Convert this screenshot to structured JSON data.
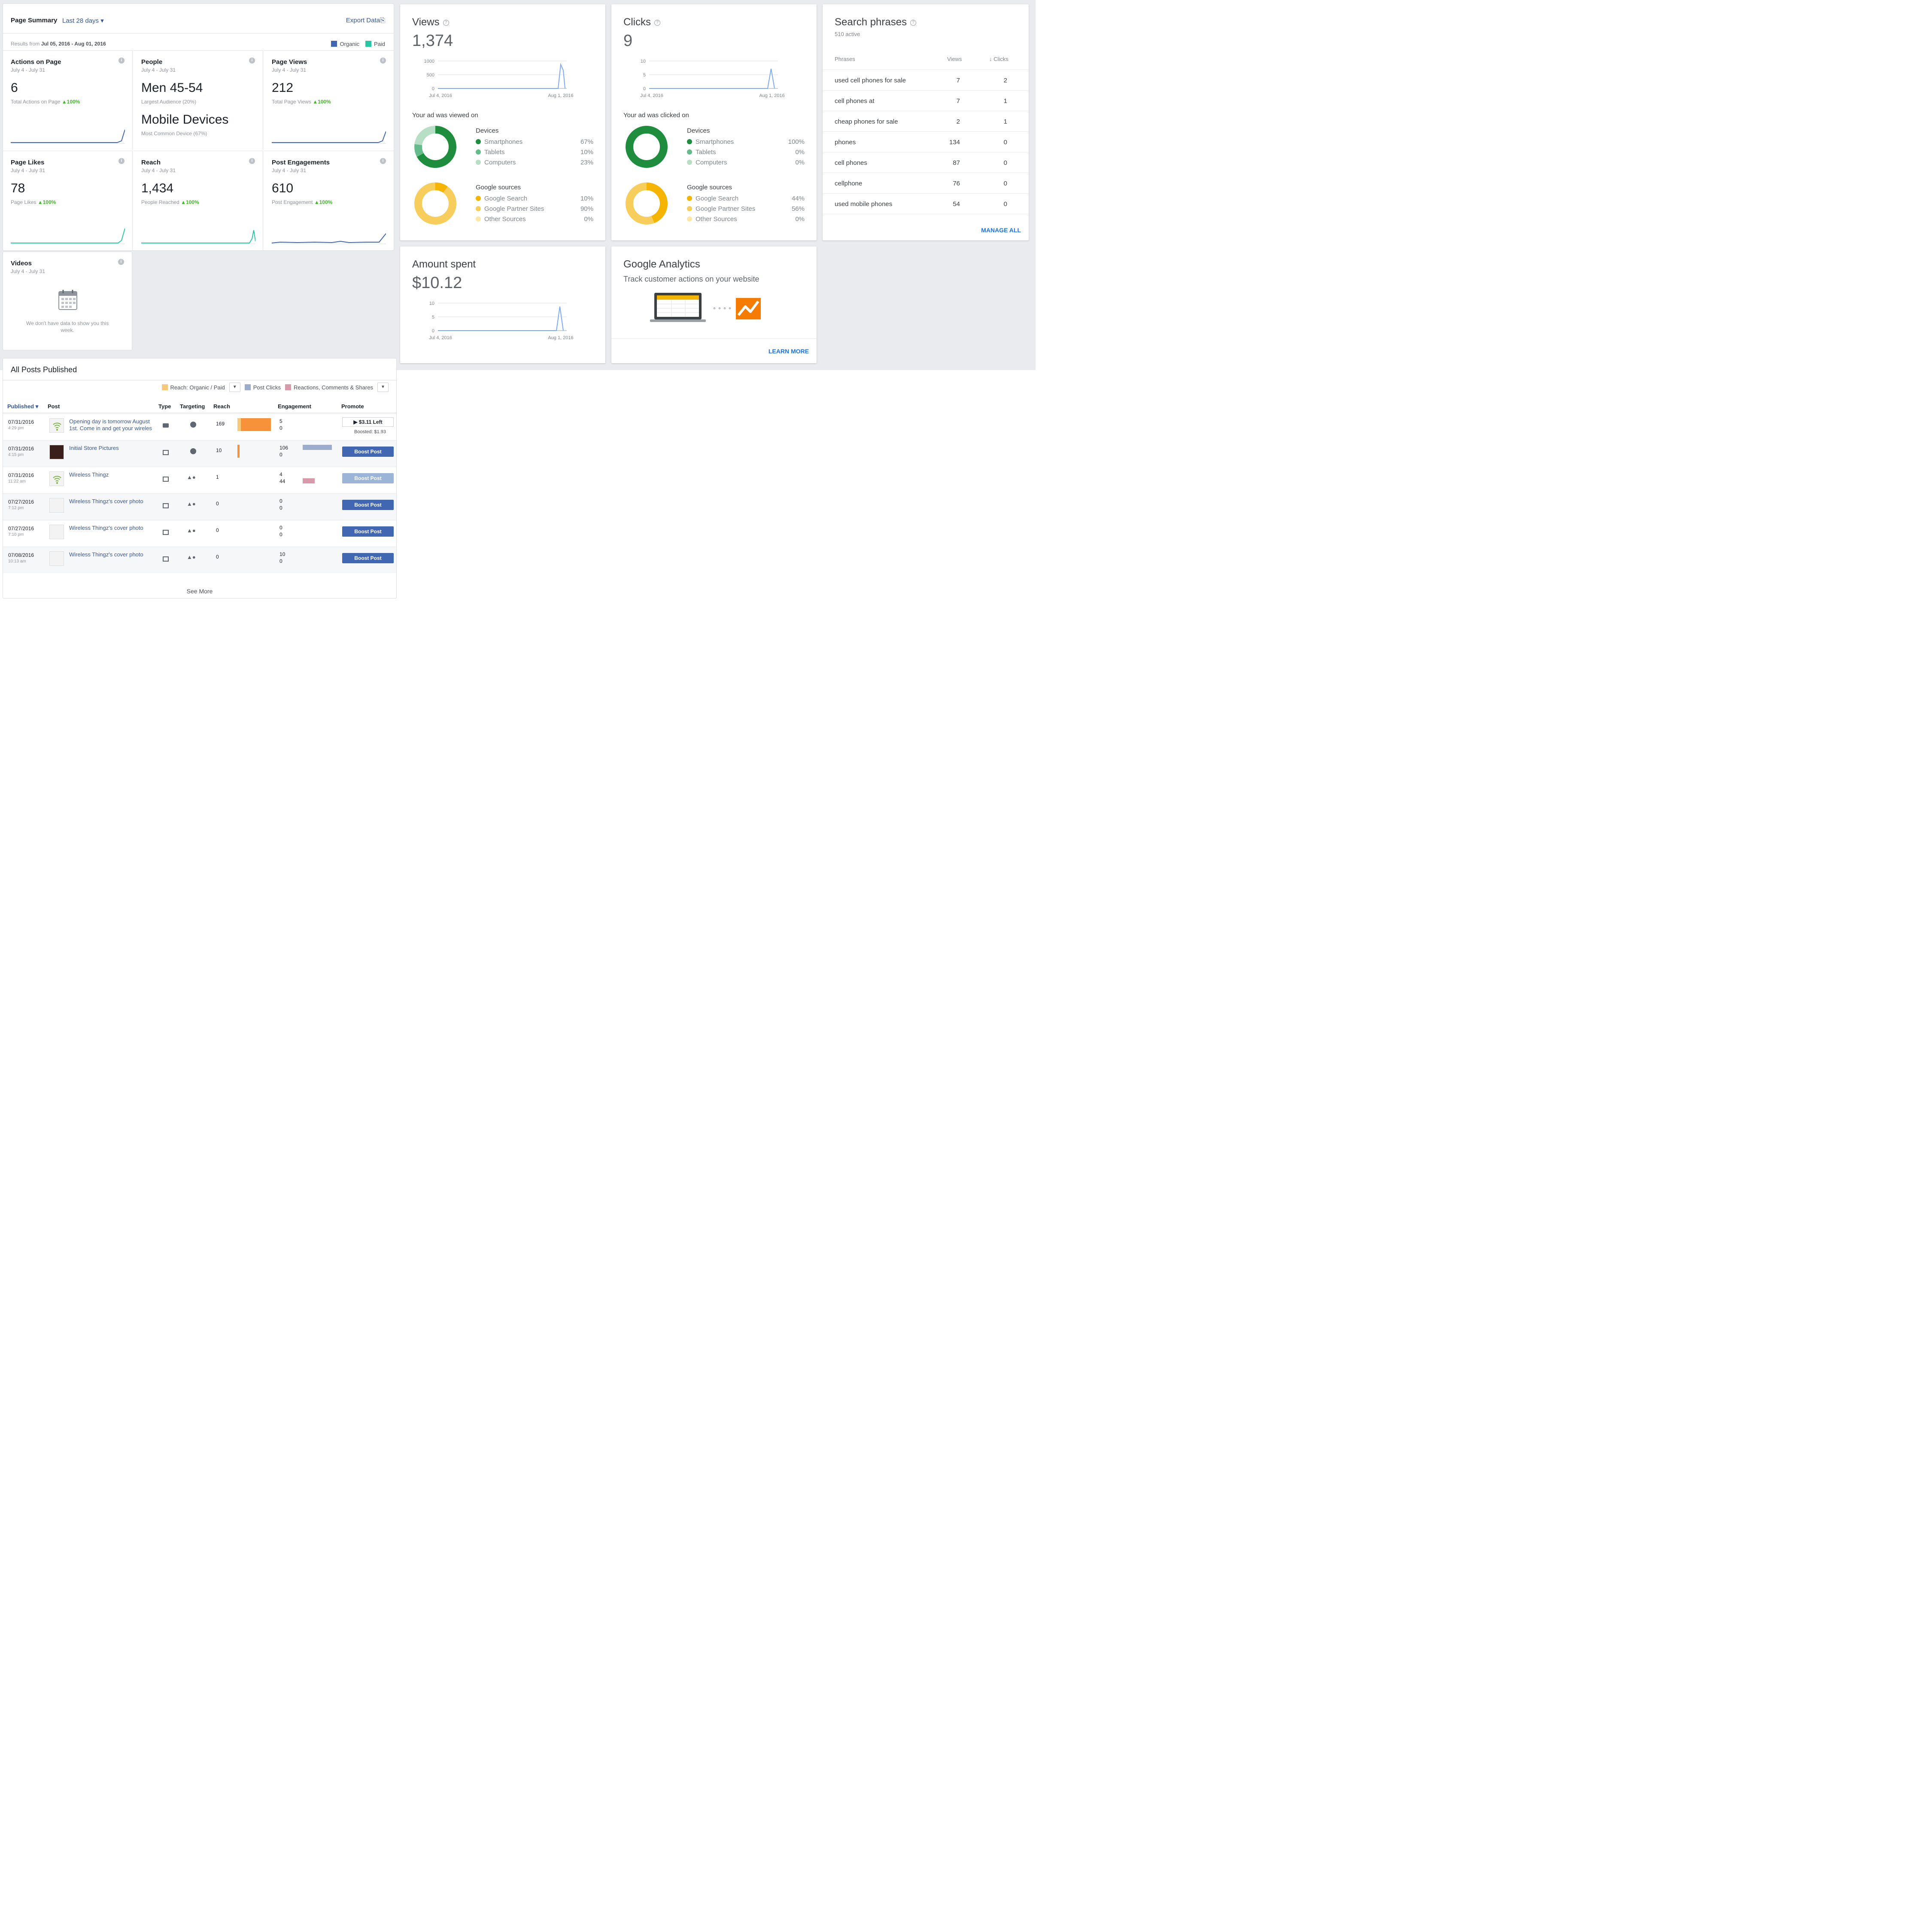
{
  "summary": {
    "title": "Page Summary",
    "range": "Last 28 days ▾",
    "export": "Export Data⎘",
    "legend": {
      "organic": "Organic",
      "paid": "Paid",
      "organic_color": "#4267b2",
      "paid_color": "#29c7a3"
    },
    "results_prefix": "Results from",
    "results_range": "Jul 05, 2016 - Aug 01, 2016",
    "tiles": [
      {
        "title": "Actions on Page",
        "date": "July 4 - July 31",
        "big": "6",
        "sub": "Total Actions on Page",
        "pct": "▲100%"
      },
      {
        "title": "People",
        "date": "July 4 - July 31",
        "big": "Men 45-54",
        "sub": "Largest Audience (20%)",
        "big2": "Mobile Devices",
        "sub2": "Most Common Device (67%)"
      },
      {
        "title": "Page Views",
        "date": "July 4 - July 31",
        "big": "212",
        "sub": "Total Page Views",
        "pct": "▲100%"
      },
      {
        "title": "Page Likes",
        "date": "July 4 - July 31",
        "big": "78",
        "sub": "Page Likes",
        "pct": "▲100%"
      },
      {
        "title": "Reach",
        "date": "July 4 - July 31",
        "big": "1,434",
        "sub": "People Reached",
        "pct": "▲100%"
      },
      {
        "title": "Post Engagements",
        "date": "July 4 - July 31",
        "big": "610",
        "sub": "Post Engagement",
        "pct": "▲100%"
      }
    ],
    "videos": {
      "title": "Videos",
      "date": "July 4 - July 31",
      "empty": "We don't have data to show you this week."
    }
  },
  "posts": {
    "title": "All Posts Published",
    "legend": [
      "Reach: Organic / Paid",
      "Post Clicks",
      "Reactions, Comments & Shares"
    ],
    "legend_colors": [
      "#f7c97a",
      "#9daccb",
      "#d79bab"
    ],
    "headers": [
      "Published ▾",
      "Post",
      "Type",
      "Targeting",
      "Reach",
      "Engagement",
      "Promote"
    ],
    "rows": [
      {
        "date": "07/31/2016",
        "time": "4:29 pm",
        "post": "Opening day is tomorrow August 1st. Come in and get your wireles",
        "reach": "169",
        "eng1": "5",
        "eng2": "0",
        "promote": "$3.11 Left",
        "boosted": "Boosted: $1.93"
      },
      {
        "date": "07/31/2016",
        "time": "4:15 pm",
        "post": "Initial Store Pictures",
        "reach": "10",
        "eng1": "106",
        "eng2": "0",
        "promote": "Boost Post"
      },
      {
        "date": "07/31/2016",
        "time": "11:22 am",
        "post": "Wireless Thingz",
        "reach": "1",
        "eng1": "4",
        "eng2": "44",
        "promote": "Boost Post"
      },
      {
        "date": "07/27/2016",
        "time": "7:12 pm",
        "post": "Wireless Thingz's cover photo",
        "reach": "0",
        "eng1": "0",
        "eng2": "0",
        "promote": "Boost Post"
      },
      {
        "date": "07/27/2016",
        "time": "7:10 pm",
        "post": "Wireless Thingz's cover photo",
        "reach": "0",
        "eng1": "0",
        "eng2": "0",
        "promote": "Boost Post"
      },
      {
        "date": "07/08/2016",
        "time": "10:13 am",
        "post": "Wireless Thingz's cover photo",
        "reach": "0",
        "eng1": "10",
        "eng2": "0",
        "promote": "Boost Post"
      }
    ],
    "see_more": "See More"
  },
  "views": {
    "title": "Views",
    "big": "1,374",
    "yticks": [
      "1000",
      "500",
      "0"
    ],
    "xticks": [
      "Jul 4, 2016",
      "Aug 1, 2016"
    ],
    "section": "Your ad was viewed on",
    "devices_title": "Devices",
    "devices": [
      {
        "label": "Smartphones",
        "pct": "67%",
        "value": 67
      },
      {
        "label": "Tablets",
        "pct": "10%",
        "value": 10
      },
      {
        "label": "Computers",
        "pct": "23%",
        "value": 23
      }
    ],
    "sources_title": "Google sources",
    "sources": [
      {
        "label": "Google Search",
        "pct": "10%",
        "value": 10
      },
      {
        "label": "Google Partner Sites",
        "pct": "90%",
        "value": 90
      },
      {
        "label": "Other Sources",
        "pct": "0%",
        "value": 0
      }
    ]
  },
  "clicks": {
    "title": "Clicks",
    "big": "9",
    "yticks": [
      "10",
      "5",
      "0"
    ],
    "xticks": [
      "Jul 4, 2016",
      "Aug 1, 2016"
    ],
    "section": "Your ad was clicked on",
    "devices_title": "Devices",
    "devices": [
      {
        "label": "Smartphones",
        "pct": "100%",
        "value": 100
      },
      {
        "label": "Tablets",
        "pct": "0%",
        "value": 0
      },
      {
        "label": "Computers",
        "pct": "0%",
        "value": 0
      }
    ],
    "sources_title": "Google sources",
    "sources": [
      {
        "label": "Google Search",
        "pct": "44%",
        "value": 44
      },
      {
        "label": "Google Partner Sites",
        "pct": "56%",
        "value": 56
      },
      {
        "label": "Other Sources",
        "pct": "0%",
        "value": 0
      }
    ]
  },
  "search": {
    "title": "Search phrases",
    "sub": "510 active",
    "headers": [
      "Phrases",
      "Views",
      "↓ Clicks"
    ],
    "rows": [
      {
        "phrase": "used cell phones for sale",
        "views": "7",
        "clicks": "2"
      },
      {
        "phrase": "cell phones at",
        "views": "7",
        "clicks": "1"
      },
      {
        "phrase": "cheap phones for sale",
        "views": "2",
        "clicks": "1"
      },
      {
        "phrase": "phones",
        "views": "134",
        "clicks": "0"
      },
      {
        "phrase": "cell phones",
        "views": "87",
        "clicks": "0"
      },
      {
        "phrase": "cellphone",
        "views": "76",
        "clicks": "0"
      },
      {
        "phrase": "used mobile phones",
        "views": "54",
        "clicks": "0"
      }
    ],
    "manage": "MANAGE ALL"
  },
  "amount": {
    "title": "Amount spent",
    "big": "$10.12",
    "yticks": [
      "10",
      "5",
      "0"
    ],
    "xticks": [
      "Jul 4, 2016",
      "Aug 1, 2016"
    ]
  },
  "analytics": {
    "title": "Google Analytics",
    "sub": "Track customer actions on your website",
    "learn": "LEARN MORE"
  },
  "colors": {
    "fb_blue": "#4267b2",
    "google_green": "#1e8e3e",
    "google_yellow": "#f4b400",
    "line": "#7baaf7"
  }
}
